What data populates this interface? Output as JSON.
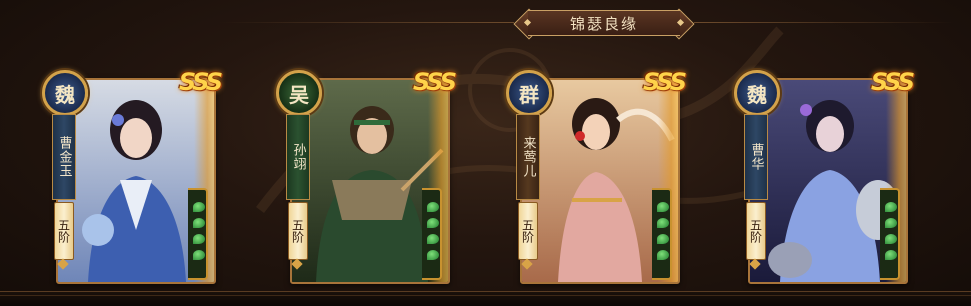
{
  "panel": {
    "title": "锦瑟良缘"
  },
  "cards": [
    {
      "badge_glyph": "魏",
      "badge_icon": "wei-faction-icon",
      "name": "曹金玉",
      "stage": "五阶",
      "rank": "SSS",
      "colors": {
        "badge": "blue",
        "name": "blue"
      }
    },
    {
      "badge_glyph": "吴",
      "badge_icon": "wu-faction-icon",
      "name": "孙翊",
      "stage": "五阶",
      "rank": "SSS",
      "colors": {
        "badge": "green",
        "name": "green"
      }
    },
    {
      "badge_glyph": "群",
      "badge_icon": "qun-faction-icon",
      "name": "来莺儿",
      "stage": "五阶",
      "rank": "SSS",
      "colors": {
        "badge": "brown",
        "name": "brown"
      }
    },
    {
      "badge_glyph": "魏",
      "badge_icon": "wei-faction-icon",
      "name": "曹华",
      "stage": "五阶",
      "rank": "SSS",
      "colors": {
        "badge": "blue",
        "name": "blue"
      }
    }
  ]
}
